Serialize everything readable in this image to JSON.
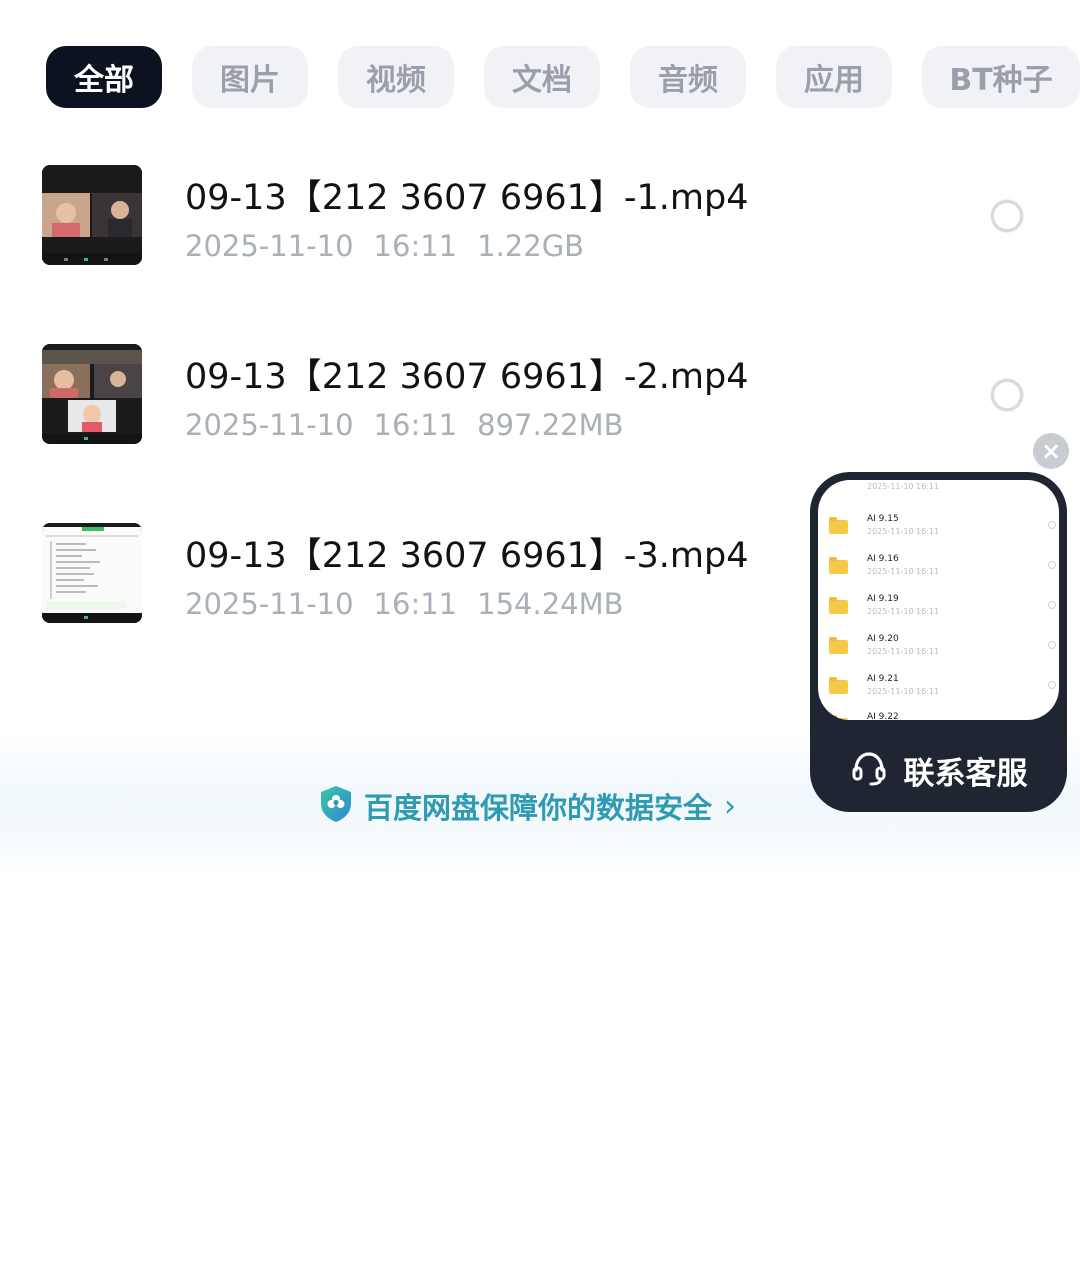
{
  "tabs": [
    {
      "label": "全部",
      "active": true
    },
    {
      "label": "图片"
    },
    {
      "label": "视频"
    },
    {
      "label": "文档"
    },
    {
      "label": "音频"
    },
    {
      "label": "应用"
    },
    {
      "label": "BT种子"
    }
  ],
  "files": [
    {
      "name": "09-13【212 3607 6961】-1.mp4",
      "date": "2025-11-10",
      "time": "16:11",
      "size": "1.22GB"
    },
    {
      "name": "09-13【212 3607 6961】-2.mp4",
      "date": "2025-11-10",
      "time": "16:11",
      "size": "897.22MB"
    },
    {
      "name": "09-13【212 3607 6961】-3.mp4",
      "date": "2025-11-10",
      "time": "16:11",
      "size": "154.24MB"
    }
  ],
  "security": {
    "text": "百度网盘保障你的数据安全",
    "chevron": "›"
  },
  "support": {
    "label": "联系客服",
    "close": "×",
    "preview_top_date": "2025-11-10 16:11",
    "preview_items": [
      {
        "name": "AI 9.15",
        "date": "2025-11-10 16:11"
      },
      {
        "name": "AI 9.16",
        "date": "2025-11-10 16:11"
      },
      {
        "name": "AI 9.19",
        "date": "2025-11-10 16:11"
      },
      {
        "name": "AI 9.20",
        "date": "2025-11-10 16:11"
      },
      {
        "name": "AI 9.21",
        "date": "2025-11-10 16:11"
      },
      {
        "name": "AI 9.22",
        "date": ""
      }
    ]
  },
  "colors": {
    "accent": "#2f9bb3",
    "active_tab": "#0c1220",
    "support_card": "#1f2533",
    "folder": "#f7c948"
  }
}
